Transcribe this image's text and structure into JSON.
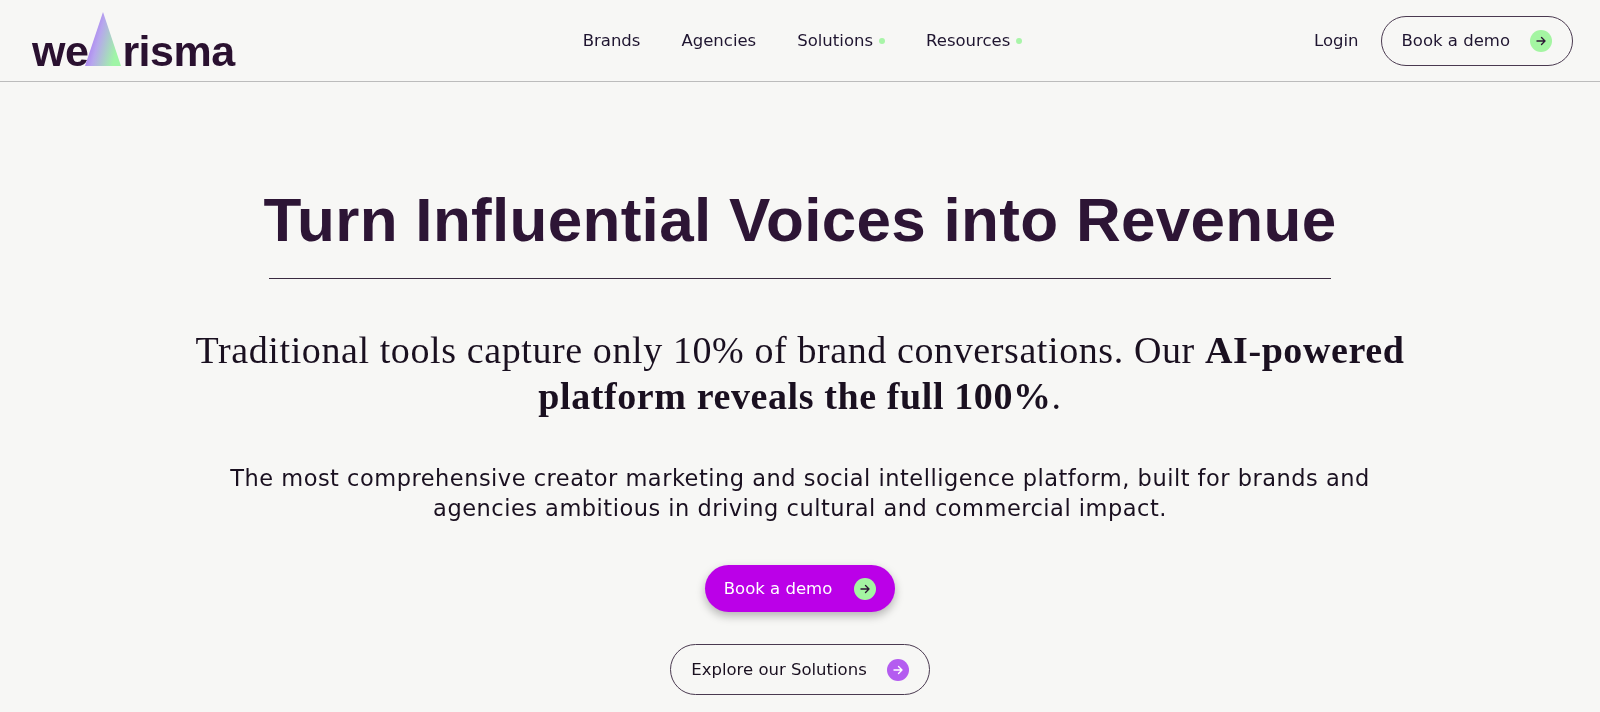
{
  "header": {
    "logo": {
      "text_before": "we",
      "text_after": "risma"
    },
    "nav": [
      {
        "label": "Brands",
        "has_dropdown": false
      },
      {
        "label": "Agencies",
        "has_dropdown": false
      },
      {
        "label": "Solutions",
        "has_dropdown": true
      },
      {
        "label": "Resources",
        "has_dropdown": true
      }
    ],
    "login": "Login",
    "cta": "Book a demo"
  },
  "hero": {
    "title": "Turn Influential Voices into Revenue",
    "subtitle": "Traditional tools capture only 10% of brand conversations. Our **AI-powered platform reveals the full 100%**.",
    "description": "The most comprehensive creator marketing and social intelligence platform, built for brands and agencies ambitious in driving cultural and commercial impact.",
    "buttons": [
      {
        "label": "Book a demo",
        "kind": "primary"
      },
      {
        "label": "Explore our Solutions",
        "kind": "secondary"
      }
    ]
  }
}
